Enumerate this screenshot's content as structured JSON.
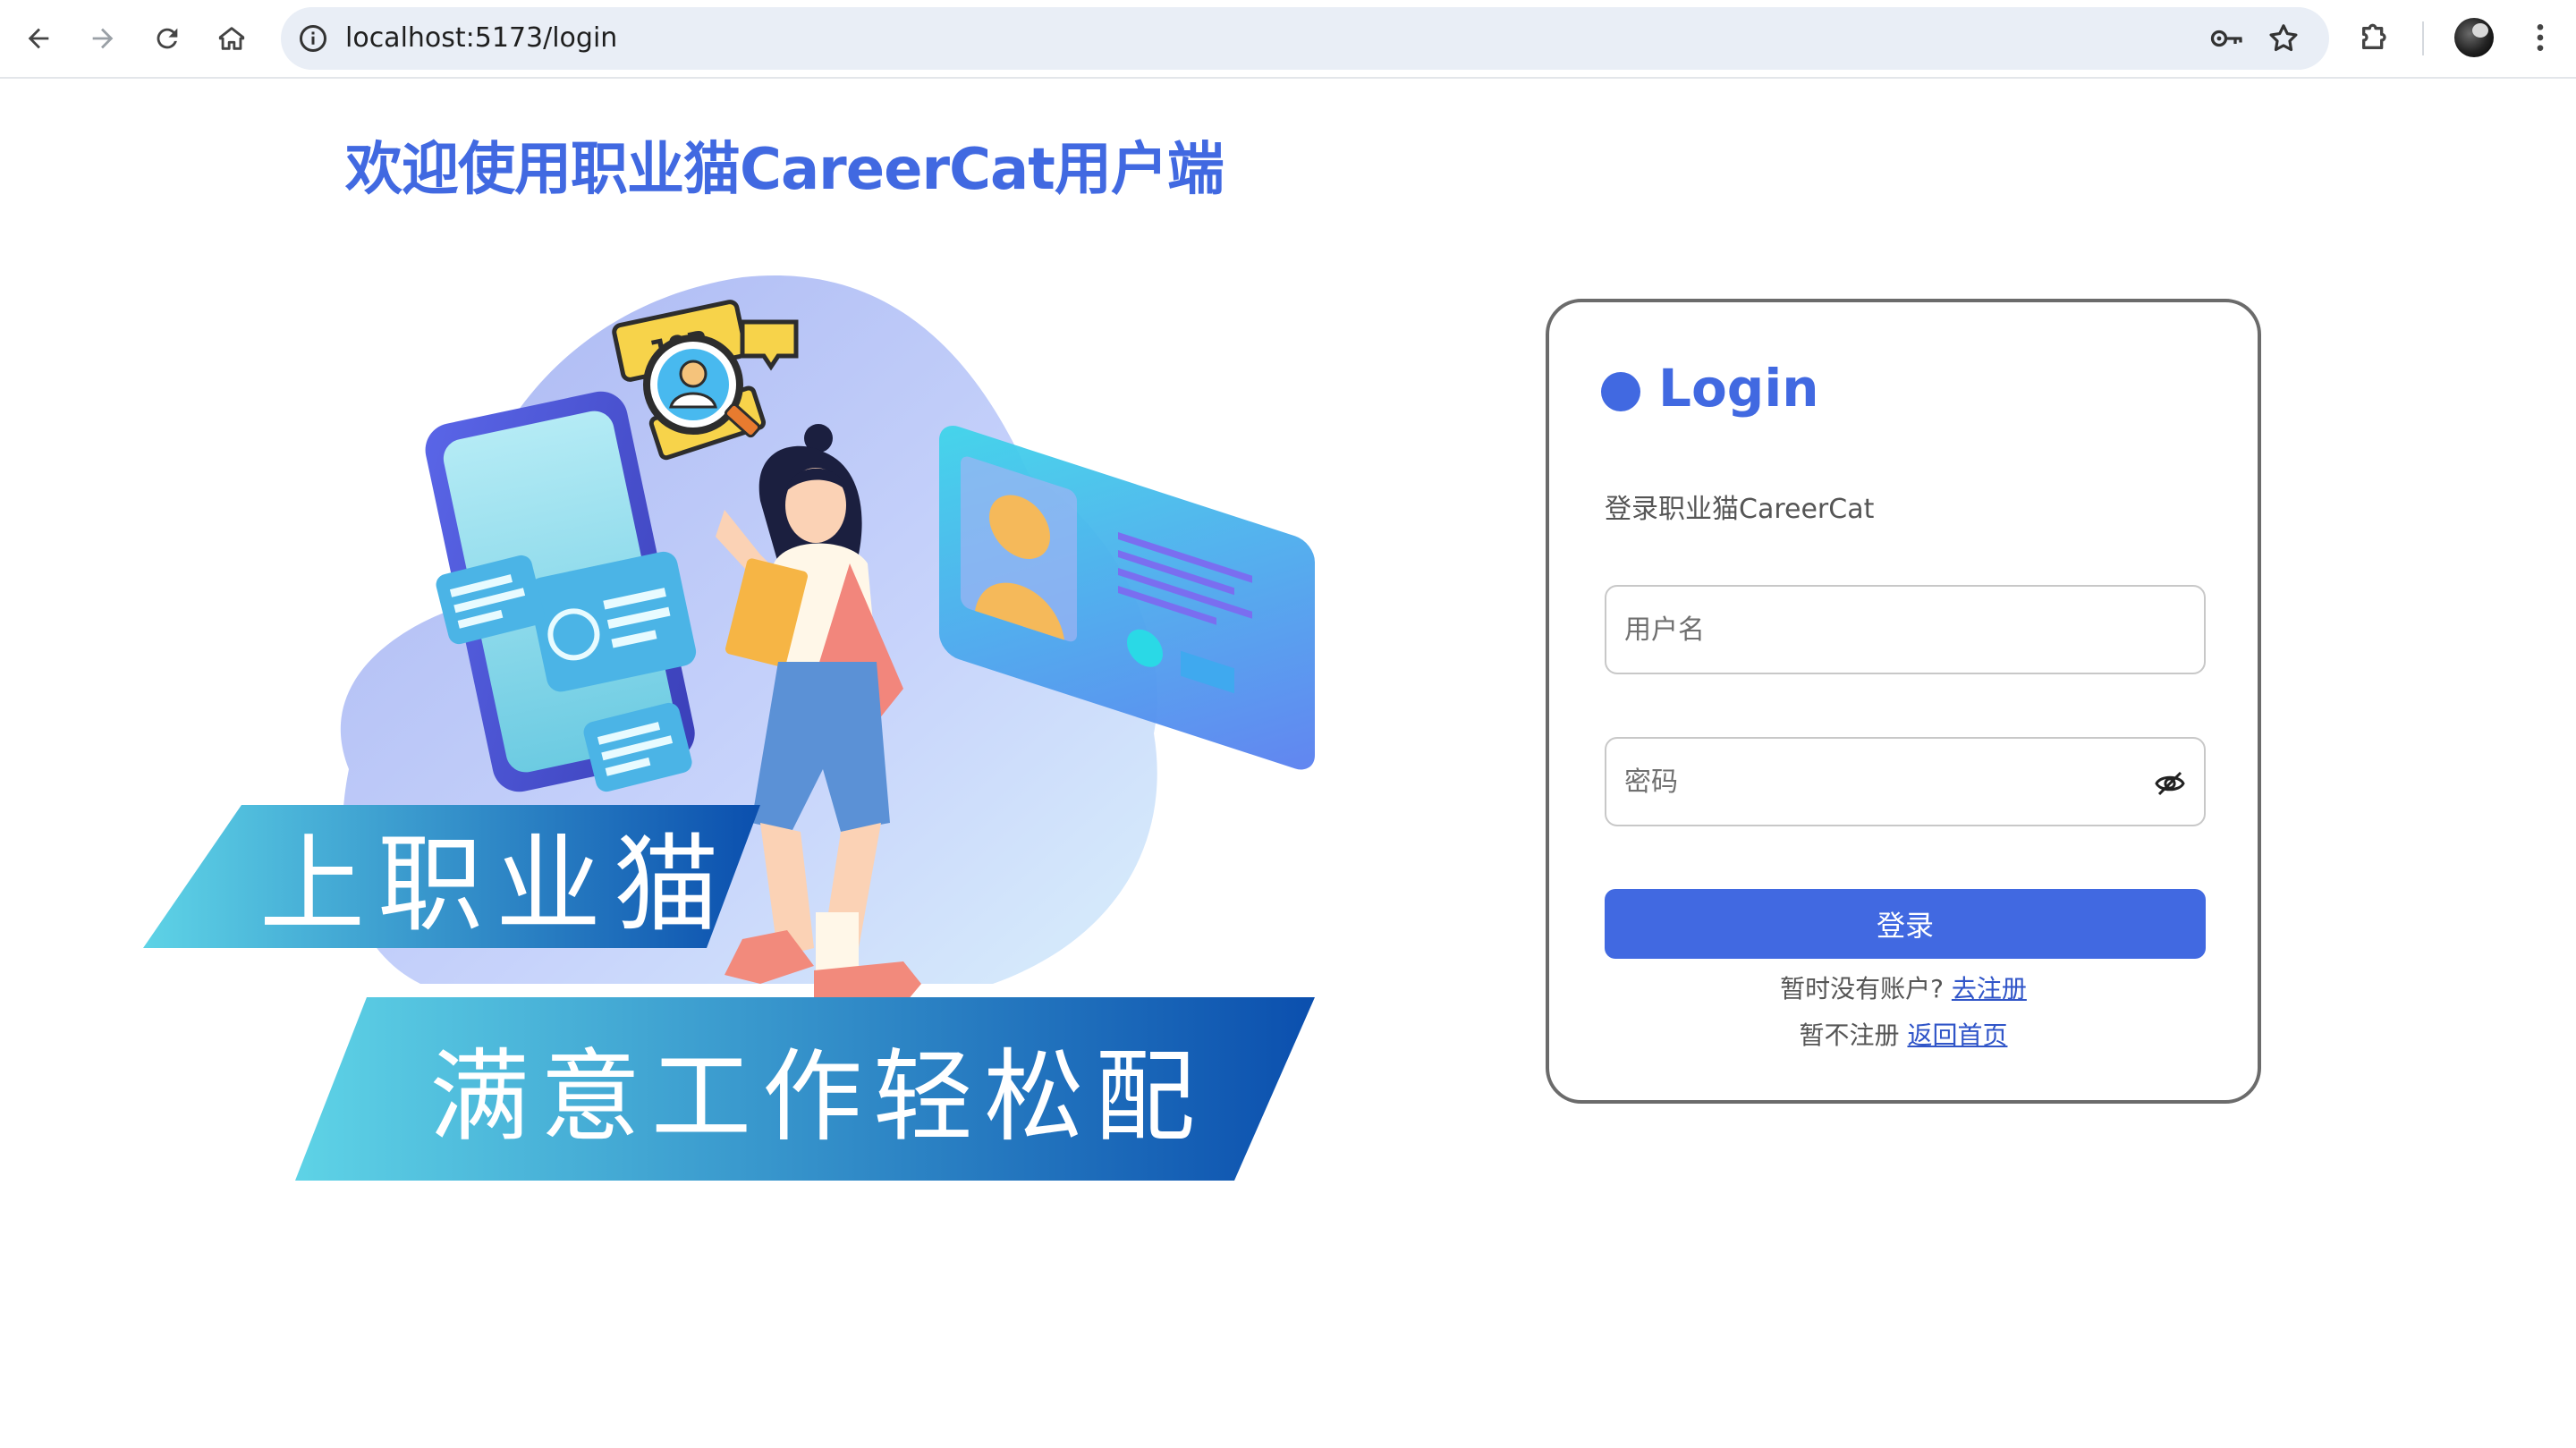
{
  "browser": {
    "url": "localhost:5173/login",
    "icons": [
      "back-arrow-icon",
      "forward-arrow-icon",
      "reload-icon",
      "home-icon",
      "site-info-icon",
      "password-key-icon",
      "bookmark-star-icon",
      "extensions-puzzle-icon",
      "profile-avatar",
      "more-menu-icon"
    ]
  },
  "page": {
    "title": "欢迎使用职业猫CareerCat用户端"
  },
  "hero": {
    "banner_line1": "上职业猫",
    "banner_line2": "满意工作轻松配",
    "job_tag": "JOB",
    "colors": {
      "banner_light": "#5ed3e6",
      "banner_dark": "#0b4fae",
      "cloud": "#b9c7f4"
    }
  },
  "login": {
    "heading": "Login",
    "subtitle": "登录职业猫CareerCat",
    "username_placeholder": "用户名",
    "password_placeholder": "密码",
    "submit_label": "登录",
    "no_account_text": "暂时没有账户?",
    "register_link": "去注册",
    "skip_text": "暂不注册",
    "home_link": "返回首页",
    "accent_color": "#4169e1"
  }
}
